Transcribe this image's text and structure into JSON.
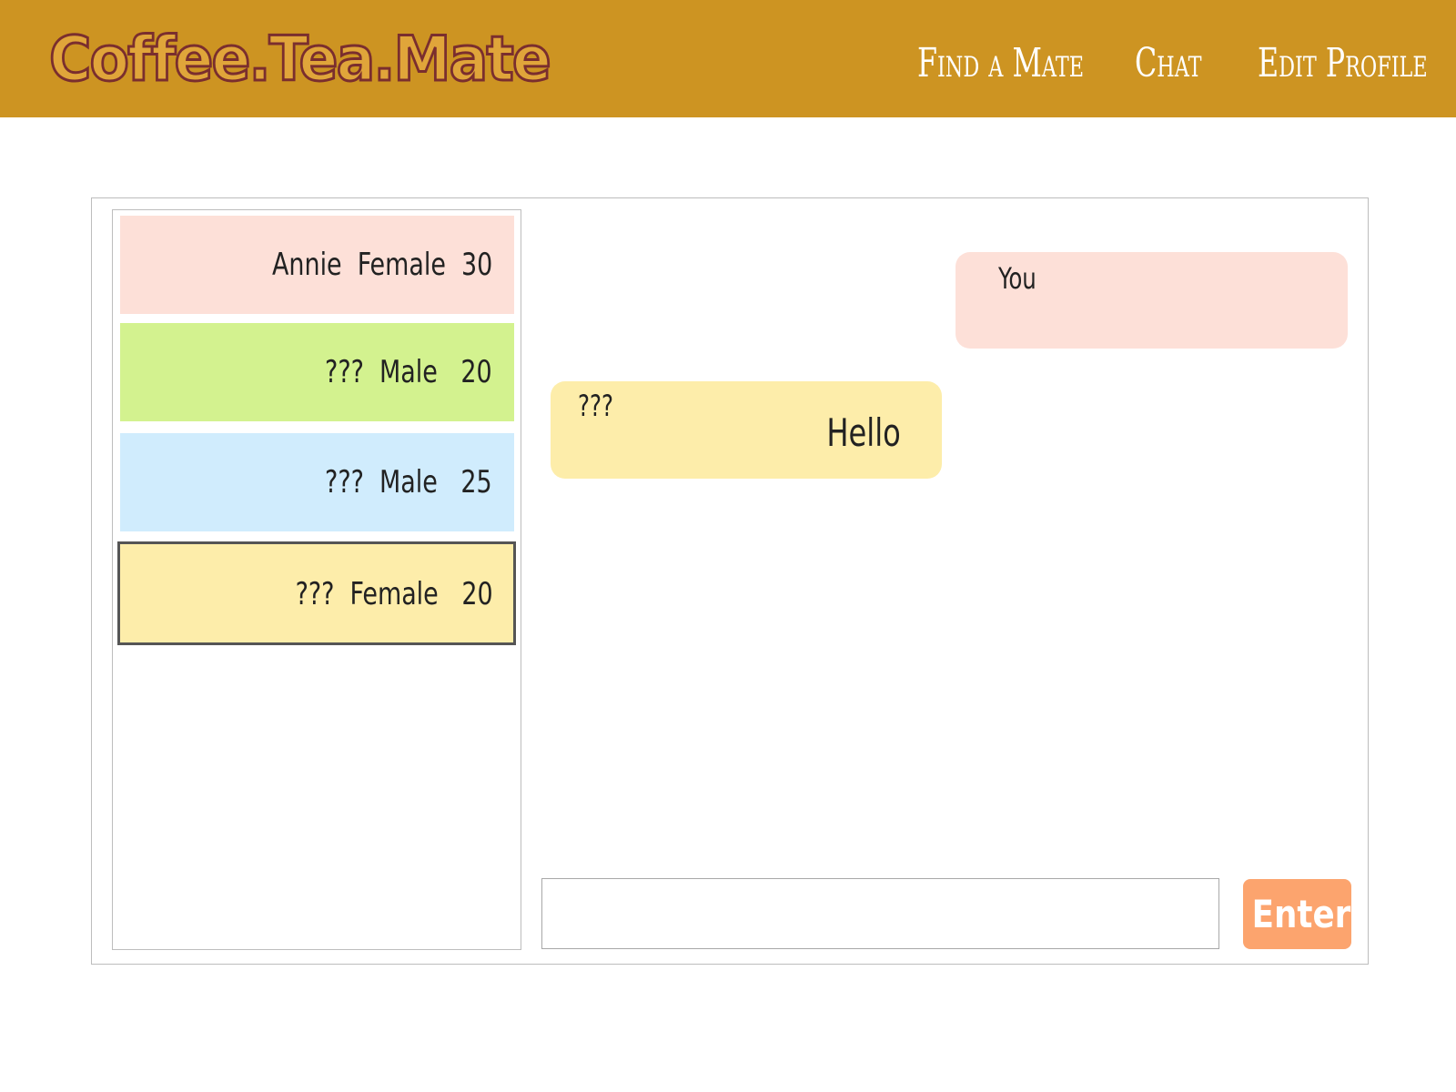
{
  "header": {
    "brand": "Coffee.Tea.Mate",
    "nav": {
      "find_a_mate": "Find a Mate",
      "chat": "Chat",
      "edit_profile": "Edit Profile"
    },
    "background_color": "#cd9422"
  },
  "mates": [
    {
      "label": "Annie  Female  30",
      "color": "#fde0d8",
      "selected": false
    },
    {
      "label": "???  Male   20",
      "color": "#d3f28f",
      "selected": false
    },
    {
      "label": "???  Male   25",
      "color": "#d0ecfd",
      "selected": false
    },
    {
      "label": "???  Female   20",
      "color": "#fdedaa",
      "selected": true
    }
  ],
  "messages": [
    {
      "sender": "You",
      "text": "",
      "color": "#fde0d8"
    },
    {
      "sender": "???",
      "text": "Hello",
      "color": "#fdedaa"
    }
  ],
  "composer": {
    "input_value": "",
    "placeholder": "",
    "enter_label": "Enter",
    "enter_color": "#fca46e"
  }
}
